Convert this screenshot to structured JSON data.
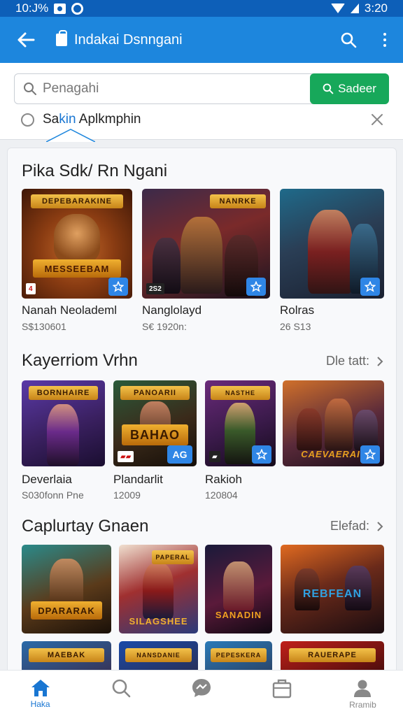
{
  "status": {
    "time_left": "10:J%",
    "time_right": "3:20"
  },
  "app_bar": {
    "title": "Indakai Dsnngani"
  },
  "search": {
    "placeholder": "Penagahi",
    "button_label": "Sadeer"
  },
  "filter": {
    "label_prefix": "Sa",
    "label_highlight": "kin",
    "label_suffix": " Aplkmphin"
  },
  "sections": [
    {
      "title": "Pika Sdk/ Rn Ngani",
      "see_all": "",
      "items": [
        {
          "name": "Nanah Neolademl",
          "meta": "S$130601",
          "banner_top": "DEPEBARAKINE",
          "banner_bottom": "MESSEEBAM"
        },
        {
          "name": "Nanglolayd",
          "meta": "S€ 1920n:",
          "banner_top": "NANRKE",
          "badge": "2S2"
        },
        {
          "name": "Rolras",
          "meta": "26 S13"
        }
      ]
    },
    {
      "title": "Kayerriom Vrhn",
      "see_all": "Dle tatt:",
      "items": [
        {
          "name": "Deverlaia",
          "meta": "S030fonn  Pne",
          "banner_top": "BORNHAIRE"
        },
        {
          "name": "Plandarlit",
          "meta": "12009",
          "banner_top": "PANOARII",
          "banner_bottom": "BAHAO",
          "badge": "AG"
        },
        {
          "name": "Rakioh",
          "meta": "120804",
          "banner_top": "NASTHE"
        },
        {
          "banner_bottom": "CAEVAERAI"
        }
      ]
    },
    {
      "title": "Caplurtay Gnaen",
      "see_all": "Elefad:",
      "items": [
        {
          "banner_bottom": "DPARARAK"
        },
        {
          "banner_top": "PAPERAL",
          "banner_bottom": "SILAGSHEE"
        },
        {
          "banner_bottom": "SANADIN"
        },
        {
          "banner_bottom": "REBFEAN"
        },
        {
          "banner_top": "MAEBAK"
        },
        {
          "banner_top": "NANSDANIE"
        },
        {
          "banner_top": "PEPESKERA"
        },
        {
          "banner_top": "RAUERAPE"
        }
      ]
    }
  ],
  "bottom_nav": [
    {
      "label": "Haka",
      "icon": "home-icon",
      "active": true
    },
    {
      "label": "",
      "icon": "search-icon"
    },
    {
      "label": "",
      "icon": "chat-icon"
    },
    {
      "label": "",
      "icon": "bag-icon"
    },
    {
      "label": "Rramib",
      "icon": "profile-icon"
    }
  ],
  "colors": {
    "app_bar": "#1d86dd",
    "status_bar": "#0d5fb8",
    "accent_green": "#17a85a",
    "active_nav": "#1976d2"
  }
}
